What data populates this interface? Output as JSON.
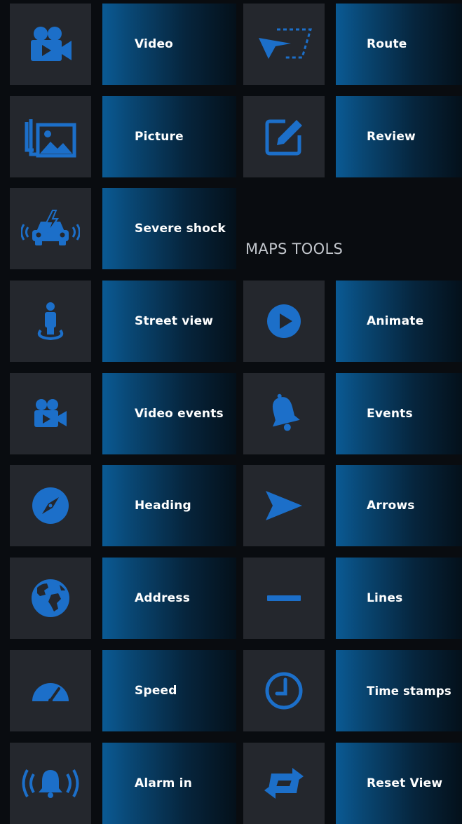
{
  "colors": {
    "background": "#090c10",
    "tile": "#24272d",
    "accent_icon": "#1c6fc9",
    "label_gradient_start": "#0a5a94",
    "label_text": "#ffffff",
    "section_title": "#c2c6cc"
  },
  "left_column": [
    {
      "label": "Video",
      "icon": "video-camera-icon"
    },
    {
      "label": "Picture",
      "icon": "picture-gallery-icon"
    },
    {
      "label": "Severe shock",
      "icon": "car-crash-icon"
    },
    {
      "label": "Street view",
      "icon": "street-view-person-icon"
    },
    {
      "label": "Video events",
      "icon": "video-camera-small-icon"
    },
    {
      "label": "Heading",
      "icon": "compass-icon"
    },
    {
      "label": "Address",
      "icon": "globe-icon"
    },
    {
      "label": "Speed",
      "icon": "speedometer-icon"
    },
    {
      "label": "Alarm in",
      "icon": "alarm-bell-icon"
    }
  ],
  "right_column_top": [
    {
      "label": "Route",
      "icon": "route-arrow-icon"
    },
    {
      "label": "Review",
      "icon": "edit-square-icon"
    }
  ],
  "section": {
    "title": "MAPS TOOLS"
  },
  "maps_tools": [
    {
      "label": "Animate",
      "icon": "play-circle-icon"
    },
    {
      "label": "Events",
      "icon": "bell-icon"
    },
    {
      "label": "Arrows",
      "icon": "arrow-pointer-icon"
    },
    {
      "label": "Lines",
      "icon": "line-icon"
    },
    {
      "label": "Time stamps",
      "icon": "clock-icon"
    },
    {
      "label": "Reset View",
      "icon": "reset-view-icon"
    }
  ]
}
